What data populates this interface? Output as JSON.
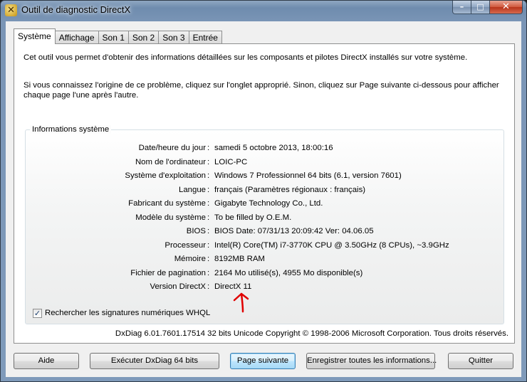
{
  "window": {
    "title": "Outil de diagnostic DirectX",
    "icon": "dxdiag-icon",
    "min_glyph": "–",
    "max_glyph": "□",
    "close_glyph": "✕"
  },
  "tabs": [
    {
      "label": "Système"
    },
    {
      "label": "Affichage"
    },
    {
      "label": "Son 1"
    },
    {
      "label": "Son 2"
    },
    {
      "label": "Son 3"
    },
    {
      "label": "Entrée"
    }
  ],
  "intro": {
    "line1": "Cet outil vous permet d'obtenir des informations détaillées sur les composants et pilotes DirectX installés sur votre système.",
    "line2": "Si vous connaissez l'origine de ce problème, cliquez sur l'onglet approprié. Sinon, cliquez sur Page suivante ci-dessous pour afficher chaque page l'une après l'autre."
  },
  "system_info": {
    "group_title": "Informations système",
    "separator": ":",
    "rows": [
      {
        "label": "Date/heure du jour",
        "value": "samedi 5 octobre 2013, 18:00:16"
      },
      {
        "label": "Nom de l'ordinateur",
        "value": "LOIC-PC"
      },
      {
        "label": "Système d'exploitation",
        "value": "Windows 7 Professionnel 64 bits (6.1, version 7601)"
      },
      {
        "label": "Langue",
        "value": "français (Paramètres régionaux : français)"
      },
      {
        "label": "Fabricant du système",
        "value": "Gigabyte Technology Co., Ltd."
      },
      {
        "label": "Modèle du système",
        "value": "To be filled by O.E.M."
      },
      {
        "label": "BIOS",
        "value": "BIOS Date: 07/31/13 20:09:42 Ver: 04.06.05"
      },
      {
        "label": "Processeur",
        "value": "Intel(R) Core(TM) i7-3770K CPU @ 3.50GHz (8 CPUs), ~3.9GHz"
      },
      {
        "label": "Mémoire",
        "value": "8192MB RAM"
      },
      {
        "label": "Fichier de pagination",
        "value": "2164 Mo utilisé(s), 4955 Mo disponible(s)"
      },
      {
        "label": "Version DirectX",
        "value": "DirectX 11"
      }
    ],
    "whql_checkbox": {
      "label": "Rechercher les signatures numériques WHQL",
      "checked": true,
      "glyph": "✓"
    }
  },
  "annotation": {
    "icon": "red-arrow-icon",
    "color": "#e00000"
  },
  "copyright": "DxDiag 6.01.7601.17514 32 bits Unicode Copyright © 1998-2006 Microsoft Corporation. Tous droits réservés.",
  "buttons": {
    "help": "Aide",
    "run64": "Exécuter DxDiag 64 bits",
    "next_page": "Page suivante",
    "save_all": "Enregistrer toutes les informations...",
    "quit": "Quitter"
  }
}
